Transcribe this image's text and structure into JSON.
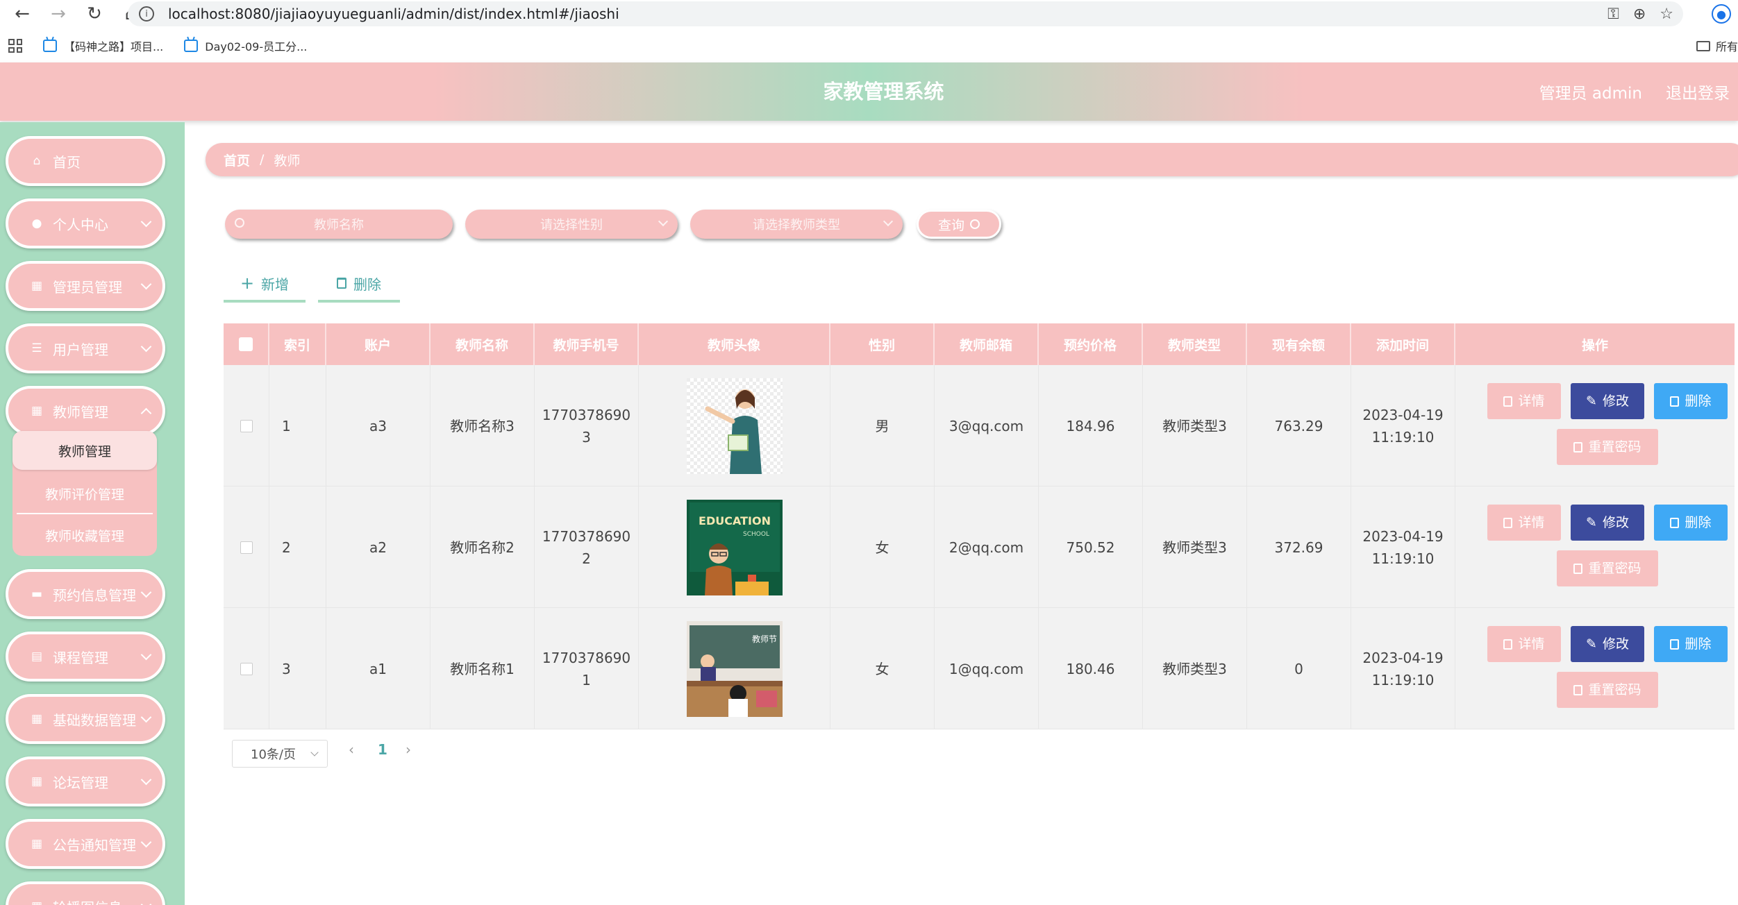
{
  "browser": {
    "url": "localhost:8080/jiajiaoyuyueguanli/admin/dist/index.html#/jiaoshi",
    "bookmarks": [
      "【码神之路】项目...",
      "Day02-09-员工分..."
    ],
    "bookmarks_all": "所有"
  },
  "header": {
    "title": "家教管理系统",
    "user": "管理员 admin",
    "logout": "退出登录"
  },
  "sidebar": {
    "items": [
      {
        "label": "首页",
        "icon": "home-icon"
      },
      {
        "label": "个人中心",
        "icon": "user-icon"
      },
      {
        "label": "管理员管理",
        "icon": "grid-icon"
      },
      {
        "label": "用户管理",
        "icon": "list-icon"
      },
      {
        "label": "教师管理",
        "icon": "grid-icon"
      },
      {
        "label": "预约信息管理",
        "icon": "monitor-icon"
      },
      {
        "label": "课程管理",
        "icon": "clipboard-icon"
      },
      {
        "label": "基础数据管理",
        "icon": "grid-icon"
      },
      {
        "label": "论坛管理",
        "icon": "grid-icon"
      },
      {
        "label": "公告通知管理",
        "icon": "grid-icon"
      },
      {
        "label": "轮播图信息",
        "icon": "grid-icon"
      }
    ],
    "submenu": [
      "教师管理",
      "教师评价管理",
      "教师收藏管理"
    ]
  },
  "breadcrumb": {
    "home": "首页",
    "sep": "/",
    "current": "教师"
  },
  "search": {
    "name_placeholder": "教师名称",
    "gender_placeholder": "请选择性别",
    "type_placeholder": "请选择教师类型",
    "query_label": "查询"
  },
  "actions": {
    "add": "新增",
    "delete": "删除"
  },
  "table": {
    "columns": [
      "索引",
      "账户",
      "教师名称",
      "教师手机号",
      "教师头像",
      "性别",
      "教师邮箱",
      "预约价格",
      "教师类型",
      "现有余额",
      "添加时间",
      "操作"
    ],
    "rows": [
      {
        "index": "1",
        "account": "a3",
        "name": "教师名称3",
        "phone1": "1770378690",
        "phone2": "3",
        "gender": "男",
        "email": "3@qq.com",
        "price": "184.96",
        "type": "教师类型3",
        "balance": "763.29",
        "date": "2023-04-19",
        "time": "11:19:10"
      },
      {
        "index": "2",
        "account": "a2",
        "name": "教师名称2",
        "phone1": "1770378690",
        "phone2": "2",
        "gender": "女",
        "email": "2@qq.com",
        "price": "750.52",
        "type": "教师类型3",
        "balance": "372.69",
        "date": "2023-04-19",
        "time": "11:19:10"
      },
      {
        "index": "3",
        "account": "a1",
        "name": "教师名称1",
        "phone1": "1770378690",
        "phone2": "1",
        "gender": "女",
        "email": "1@qq.com",
        "price": "180.46",
        "type": "教师类型3",
        "balance": "0",
        "date": "2023-04-19",
        "time": "11:19:10"
      }
    ],
    "buttons": {
      "detail": "详情",
      "edit": "修改",
      "delete": "删除",
      "reset": "重置密码"
    },
    "avatar_texts": {
      "education": "EDUCATION",
      "school": "SCHOOL",
      "festival": "教师节"
    }
  },
  "pagination": {
    "page_size": "10条/页",
    "current_page": "1"
  },
  "colors": {
    "pink": "#f7c1c1",
    "mint": "#a8dcc0",
    "edit": "#3c4b9d",
    "delete": "#3fa9f5"
  }
}
